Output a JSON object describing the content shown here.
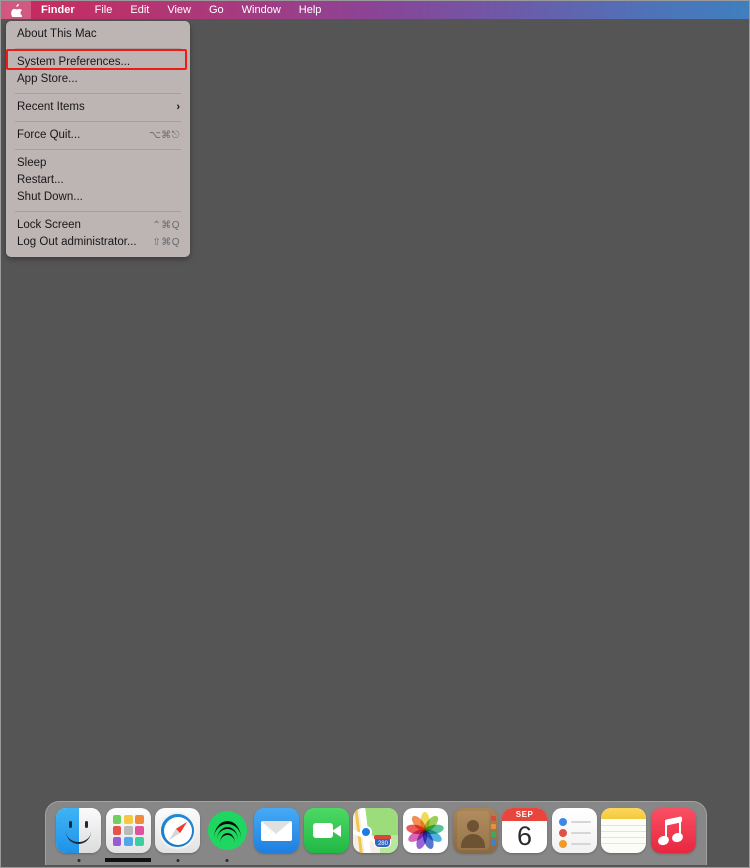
{
  "menubar": {
    "apple_icon": "apple-logo-icon",
    "items": [
      {
        "label": "Finder",
        "bold": true
      },
      {
        "label": "File",
        "bold": false
      },
      {
        "label": "Edit",
        "bold": false
      },
      {
        "label": "View",
        "bold": false
      },
      {
        "label": "Go",
        "bold": false
      },
      {
        "label": "Window",
        "bold": false
      },
      {
        "label": "Help",
        "bold": false
      }
    ]
  },
  "apple_menu": {
    "items": [
      {
        "label": "About This Mac",
        "shortcut": "",
        "submenu": false
      },
      {
        "label": "System Preferences...",
        "shortcut": "",
        "submenu": false,
        "highlighted": true
      },
      {
        "label": "App Store...",
        "shortcut": "",
        "submenu": false
      },
      {
        "label": "Recent Items",
        "shortcut": "",
        "submenu": true
      },
      {
        "label": "Force Quit...",
        "shortcut": "⌥⌘⎋",
        "submenu": false
      },
      {
        "label": "Sleep",
        "shortcut": "",
        "submenu": false
      },
      {
        "label": "Restart...",
        "shortcut": "",
        "submenu": false
      },
      {
        "label": "Shut Down...",
        "shortcut": "",
        "submenu": false
      },
      {
        "label": "Lock Screen",
        "shortcut": "⌃⌘Q",
        "submenu": false
      },
      {
        "label": "Log Out administrator...",
        "shortcut": "⇧⌘Q",
        "submenu": false
      }
    ],
    "submenu_chevron": "›",
    "highlight_color": "#ee1b16"
  },
  "dock": {
    "items": [
      {
        "name": "Finder",
        "icon": "finder-icon",
        "running": "dot"
      },
      {
        "name": "Launchpad",
        "icon": "launchpad-icon",
        "running": "bar"
      },
      {
        "name": "Safari",
        "icon": "safari-icon",
        "running": "dot"
      },
      {
        "name": "Spotify",
        "icon": "spotify-icon",
        "running": "dot"
      },
      {
        "name": "Mail",
        "icon": "mail-icon",
        "running": "none"
      },
      {
        "name": "FaceTime",
        "icon": "facetime-icon",
        "running": "none"
      },
      {
        "name": "Maps",
        "icon": "maps-icon",
        "running": "none"
      },
      {
        "name": "Photos",
        "icon": "photos-icon",
        "running": "none"
      },
      {
        "name": "Contacts",
        "icon": "contacts-icon",
        "running": "none"
      },
      {
        "name": "Calendar",
        "icon": "calendar-icon",
        "running": "none"
      },
      {
        "name": "Reminders",
        "icon": "reminders-icon",
        "running": "none"
      },
      {
        "name": "Notes",
        "icon": "notes-icon",
        "running": "none"
      },
      {
        "name": "Music",
        "icon": "music-icon",
        "running": "none"
      }
    ]
  },
  "calendar_icon": {
    "month": "SEP",
    "day": "6"
  },
  "maps_icon": {
    "shield_number": "280"
  },
  "colors": {
    "desktop": "#555555",
    "menu_panel": "#bdb4b4",
    "annotation_red": "#ee1b16",
    "dock_panel": "#8c8c8c"
  }
}
